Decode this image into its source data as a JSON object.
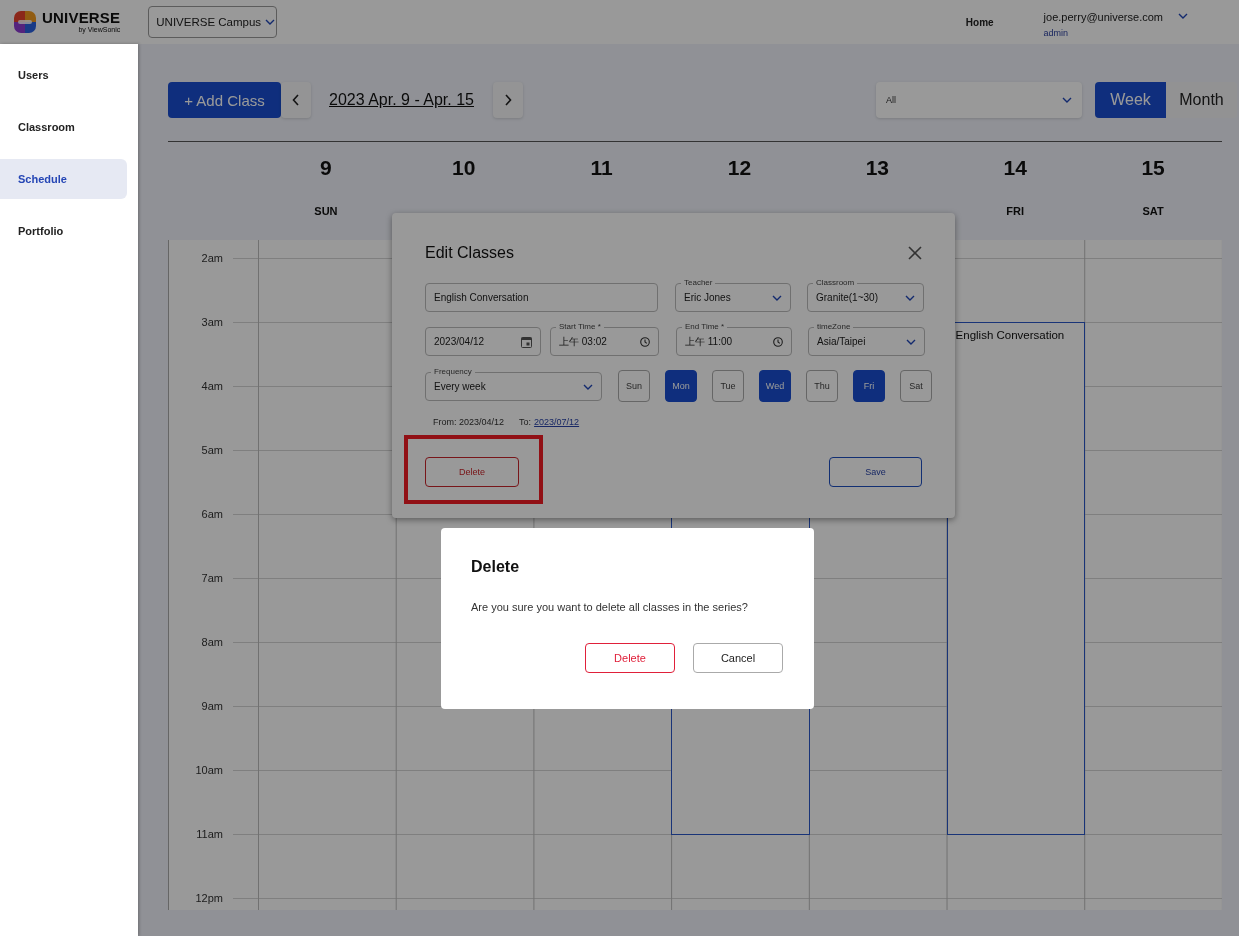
{
  "header": {
    "logo": {
      "name": "UNIVERSE",
      "tagline": "by ViewSonic"
    },
    "campus_select": {
      "value": "UNIVERSE Campus"
    },
    "nav_link": "Home",
    "user": {
      "email": "joe.perry@universe.com",
      "role": "admin"
    }
  },
  "sidebar": {
    "items": [
      {
        "label": "Users",
        "selected": false
      },
      {
        "label": "Classroom",
        "selected": false
      },
      {
        "label": "Schedule",
        "selected": true
      },
      {
        "label": "Portfolio",
        "selected": false
      }
    ]
  },
  "toolbar": {
    "add_button": "+ Add Class",
    "date_range": "2023 Apr. 9 - Apr. 15",
    "filter": {
      "value": "All"
    },
    "views": [
      {
        "label": "Week",
        "selected": true
      },
      {
        "label": "Month",
        "selected": false
      }
    ]
  },
  "calendar": {
    "days": [
      {
        "date": "9",
        "weekday": "SUN"
      },
      {
        "date": "10"
      },
      {
        "date": "11"
      },
      {
        "date": "12",
        "events": [
          {
            "kind": "class"
          }
        ]
      },
      {
        "date": "13"
      },
      {
        "date": "14",
        "weekday": "FRI",
        "events": [
          {
            "kind": "class",
            "title": "English Conversation"
          }
        ]
      },
      {
        "date": "15",
        "weekday": "SAT"
      }
    ],
    "hours": [
      "2am",
      "3am",
      "4am",
      "5am",
      "6am",
      "7am",
      "8am",
      "9am",
      "10am",
      "11am",
      "12pm"
    ]
  },
  "edit_dialog": {
    "title": "Edit Classes",
    "fields": [
      {
        "kind": "text",
        "value": "English Conversation"
      },
      {
        "kind": "select",
        "label": "Teacher",
        "value": "Eric Jones"
      },
      {
        "kind": "select",
        "label": "Classroom",
        "value": "Granite(1~30)"
      },
      {
        "kind": "date",
        "value": "2023/04/12"
      },
      {
        "kind": "time",
        "label": "Start Time *",
        "value": "上午 03:02"
      },
      {
        "kind": "time",
        "label": "End Time *",
        "value": "上午 11:00"
      },
      {
        "kind": "select",
        "label": "timeZone",
        "value": "Asia/Taipei"
      },
      {
        "kind": "select",
        "label": "Frequency",
        "value": "Every week"
      }
    ],
    "weekdays": [
      {
        "label": "Sun",
        "selected": false
      },
      {
        "label": "Mon",
        "selected": true
      },
      {
        "label": "Tue",
        "selected": false
      },
      {
        "label": "Wed",
        "selected": true
      },
      {
        "label": "Thu",
        "selected": false
      },
      {
        "label": "Fri",
        "selected": true
      },
      {
        "label": "Sat",
        "selected": false
      }
    ],
    "range": {
      "from": "From: 2023/04/12",
      "to_label": "To:",
      "to_date": "2023/07/12"
    },
    "delete_button": {
      "label": "Delete",
      "highlighted": true
    },
    "save_button": "Save"
  },
  "confirm_dialog": {
    "title": "Delete",
    "message": "Are you sure you want to delete all classes in the series?",
    "buttons": [
      {
        "kind": "danger",
        "label": "Delete"
      },
      {
        "kind": "default",
        "label": "Cancel"
      }
    ]
  }
}
